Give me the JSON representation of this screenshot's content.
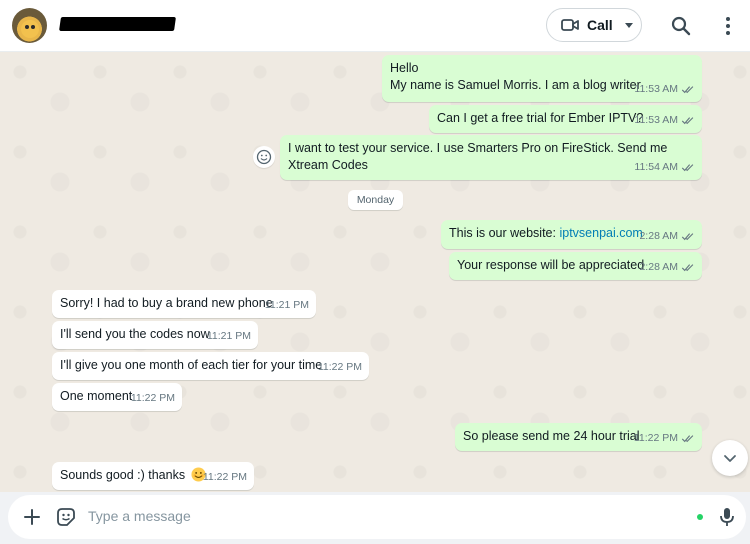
{
  "header": {
    "call_label": "Call"
  },
  "composer": {
    "placeholder": "Type a message"
  },
  "day_separator": "Monday",
  "messages": [
    {
      "dir": "out",
      "text_lines": [
        "Hello",
        "My name is Samuel Morris. I am a blog writer"
      ],
      "time": "11:53 AM",
      "status": "read"
    },
    {
      "dir": "out",
      "text": "Can I get a free trial for Ember IPTV?",
      "time": "11:53 AM",
      "status": "read"
    },
    {
      "dir": "out",
      "text_lines": [
        "I want to test your service. I use Smarters Pro on FireStick. Send me",
        "Xtream Codes"
      ],
      "time": "11:54 AM",
      "status": "read"
    },
    {
      "dir": "out",
      "text": "This is our website: ",
      "link": "iptvsenpai.com",
      "time": "2:28 AM",
      "status": "read"
    },
    {
      "dir": "out",
      "text": "Your response will be appreciated",
      "time": "2:28 AM",
      "status": "read"
    },
    {
      "dir": "in",
      "text": "Sorry! I had to buy a brand new phone",
      "time": "11:21 PM"
    },
    {
      "dir": "in",
      "text": "I'll send you the codes now",
      "time": "11:21 PM"
    },
    {
      "dir": "in",
      "text": "I'll give you one month of each tier for your time",
      "time": "11:22 PM"
    },
    {
      "dir": "in",
      "text": "One moment",
      "time": "11:22 PM"
    },
    {
      "dir": "out",
      "text": "So please send me 24 hour trial",
      "time": "11:22 PM",
      "status": "read"
    },
    {
      "dir": "in",
      "text": "Sounds good :) thanks",
      "emoji": "smiling-face",
      "time": "11:22 PM"
    }
  ],
  "icons": {
    "call": "video-camera-icon",
    "search": "search-icon",
    "menu": "kebab-menu-icon",
    "react": "emoji-react-icon",
    "scroll": "chevron-down-icon",
    "attach": "plus-icon",
    "sticker": "sticker-icon",
    "mic": "microphone-icon",
    "read_receipt": "double-check-icon"
  },
  "colors": {
    "outgoing_bubble": "#d9fdd3",
    "incoming_bubble": "#ffffff",
    "chat_background": "#efeae2",
    "read_ticks": "#53bdeb",
    "link": "#027eb5"
  }
}
